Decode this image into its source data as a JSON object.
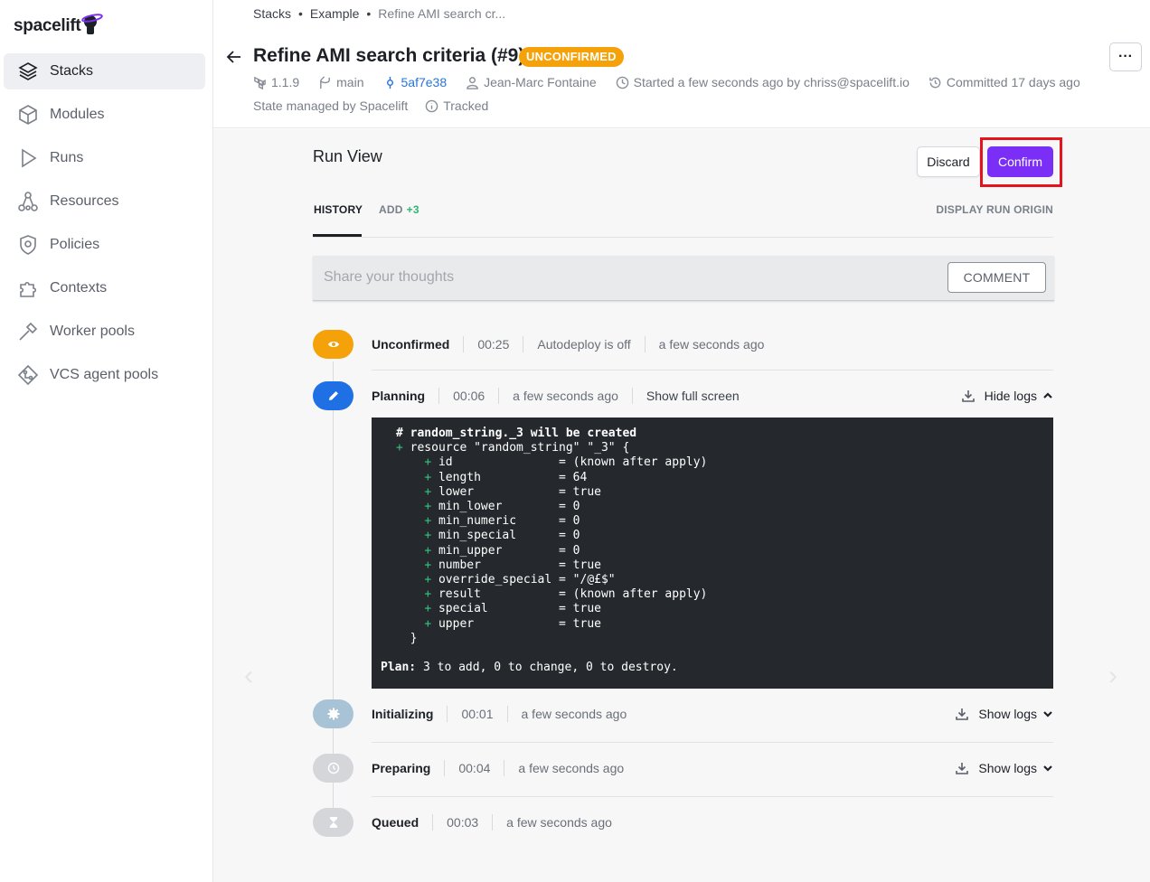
{
  "brand": {
    "name": "spacelift"
  },
  "sidebar": {
    "items": [
      {
        "label": "Stacks",
        "icon": "layers-icon",
        "active": true
      },
      {
        "label": "Modules",
        "icon": "cube-icon"
      },
      {
        "label": "Runs",
        "icon": "play-icon"
      },
      {
        "label": "Resources",
        "icon": "network-icon"
      },
      {
        "label": "Policies",
        "icon": "shield-icon"
      },
      {
        "label": "Contexts",
        "icon": "puzzle-icon"
      },
      {
        "label": "Worker pools",
        "icon": "hammer-icon"
      },
      {
        "label": "VCS agent pools",
        "icon": "vcs-icon"
      }
    ]
  },
  "breadcrumb": {
    "root": "Stacks",
    "sep": "•",
    "stack": "Example",
    "current": "Refine AMI search cr..."
  },
  "header": {
    "title": "Refine AMI search criteria (#9)",
    "badge": "UNCONFIRMED",
    "meta": {
      "version": "1.1.9",
      "branch": "main",
      "commit": "5af7e38",
      "author": "Jean-Marc Fontaine",
      "started": "Started a few seconds ago by chriss@spacelift.io",
      "committed": "Committed 17 days ago",
      "state": "State managed by Spacelift",
      "tracked": "Tracked"
    },
    "more_label": "···"
  },
  "run_view": {
    "title": "Run View",
    "discard_label": "Discard",
    "confirm_label": "Confirm",
    "tabs": {
      "history": "HISTORY",
      "add": "ADD",
      "add_count": "+3",
      "origin": "DISPLAY RUN ORIGIN"
    },
    "comment": {
      "placeholder": "Share your thoughts",
      "button": "COMMENT"
    }
  },
  "steps": {
    "unconfirmed": {
      "name": "Unconfirmed",
      "duration": "00:25",
      "note": "Autodeploy is off",
      "time": "a few seconds ago",
      "color": "#f5a20a"
    },
    "planning": {
      "name": "Planning",
      "duration": "00:06",
      "time": "a few seconds ago",
      "fullscreen": "Show full screen",
      "logs": "Hide logs",
      "color": "#1f6fe5"
    },
    "initializing": {
      "name": "Initializing",
      "duration": "00:01",
      "time": "a few seconds ago",
      "logs": "Show logs",
      "color": "#a9c3d6"
    },
    "preparing": {
      "name": "Preparing",
      "duration": "00:04",
      "time": "a few seconds ago",
      "logs": "Show logs",
      "color": "#d5d6da"
    },
    "queued": {
      "name": "Queued",
      "duration": "00:03",
      "time": "a few seconds ago",
      "color": "#d5d6da"
    }
  },
  "log": {
    "comment": "# random_string._3 will be created",
    "resource": "resource \"random_string\" \"_3\" {",
    "attrs": [
      "id               = (known after apply)",
      "length           = 64",
      "lower            = true",
      "min_lower        = 0",
      "min_numeric      = 0",
      "min_special      = 0",
      "min_upper        = 0",
      "number           = true",
      "override_special = \"/@£$\"",
      "result           = (known after apply)",
      "special          = true",
      "upper            = true"
    ],
    "close": "}",
    "plan_label": "Plan:",
    "plan_text": "3 to add, 0 to change, 0 to destroy."
  }
}
